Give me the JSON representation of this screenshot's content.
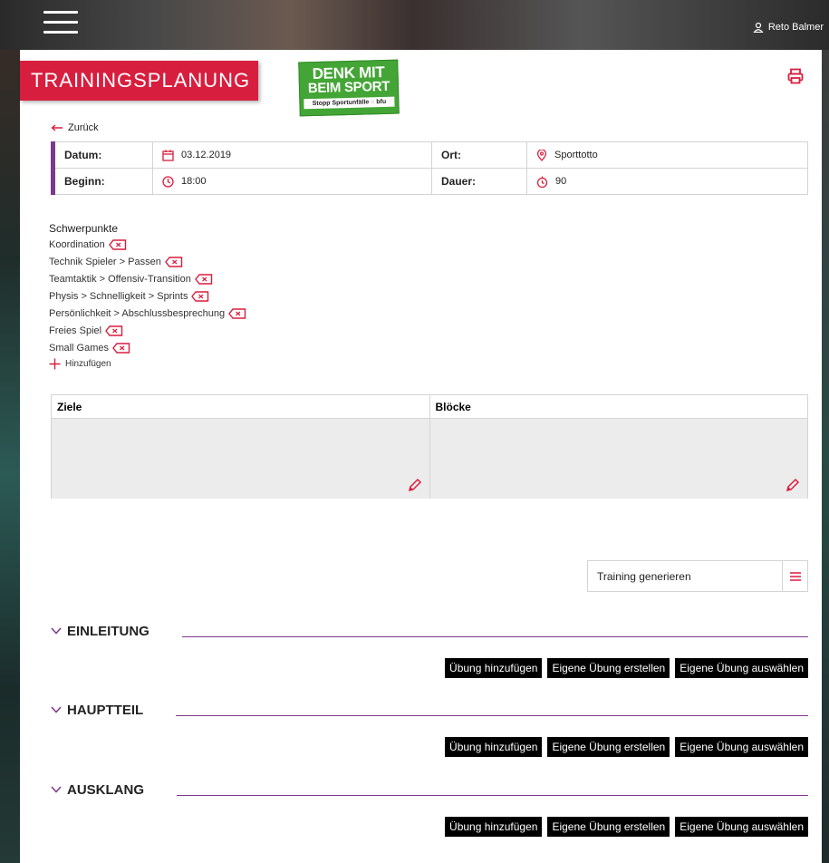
{
  "user": {
    "name": "Reto Balmer",
    "icon": "user-icon"
  },
  "header": {
    "title": "TRAININGSPLANUNG"
  },
  "logo": {
    "line1": "DENK MIT",
    "line2": "BEIM SPORT",
    "tagline": "Stopp Sportunfälle  ◌ bfu"
  },
  "nav": {
    "back_label": "Zurück"
  },
  "info": {
    "datum_label": "Datum:",
    "datum_value": "03.12.2019",
    "ort_label": "Ort:",
    "ort_value": "Sporttotto",
    "beginn_label": "Beginn:",
    "beginn_value": "18:00",
    "dauer_label": "Dauer:",
    "dauer_value": "90"
  },
  "schwerpunkte": {
    "heading": "Schwerpunkte",
    "items": [
      "Koordination",
      "Technik Spieler > Passen",
      "Teamtaktik > Offensiv-Transition",
      "Physis > Schnelligkeit > Sprints",
      "Persönlichkeit > Abschlussbesprechung",
      "Freies Spiel",
      "Small Games"
    ],
    "add_label": "Hinzufügen"
  },
  "panels": {
    "ziele_label": "Ziele",
    "bloecke_label": "Blöcke"
  },
  "generate": {
    "label": "Training generieren"
  },
  "sections": [
    {
      "title": "EINLEITUNG"
    },
    {
      "title": "HAUPTTEIL"
    },
    {
      "title": "AUSKLANG"
    }
  ],
  "buttons": {
    "add_exercise": "Übung hinzufügen",
    "create_own": "Eigene Übung erstellen",
    "select_own": "Eigene Übung auswählen"
  },
  "colors": {
    "accent_red": "#d81e3e",
    "accent_purple": "#7b3a8a",
    "logo_green": "#43a535"
  }
}
